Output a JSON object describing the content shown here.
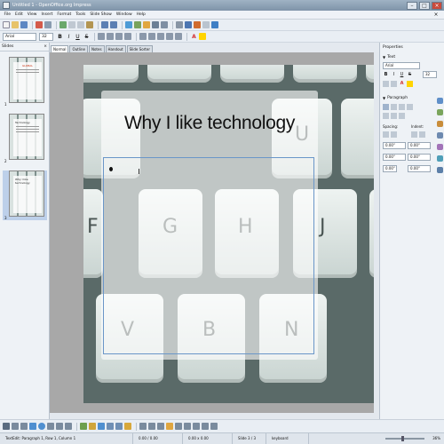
{
  "window": {
    "title": "Untitled 1 - OpenOffice.org Impress"
  },
  "menubar": [
    "File",
    "Edit",
    "View",
    "Insert",
    "Format",
    "Tools",
    "Slide Show",
    "Window",
    "Help"
  ],
  "formatting": {
    "font_name": "Arial",
    "font_size": "32",
    "buttons": [
      "B",
      "I",
      "U",
      "S",
      "A"
    ]
  },
  "slides_pane": {
    "title": "Slides",
    "thumbnails": [
      {
        "number": "1",
        "text": "GLOBAL"
      },
      {
        "number": "2",
        "text": "Technology"
      },
      {
        "number": "3",
        "text": "Why I like technology"
      }
    ]
  },
  "view_tabs": [
    "Normal",
    "Outline",
    "Notes",
    "Handout",
    "Slide Sorter"
  ],
  "slide": {
    "title": "Why I like technology",
    "key_letters": [
      "G",
      "H",
      "F",
      "J",
      "V",
      "B",
      "N",
      "U"
    ]
  },
  "properties": {
    "title": "Properties",
    "text_section": "Text",
    "font": "Arial",
    "size": "32",
    "paragraph_section": "Paragraph",
    "spacing_label": "Spacing:",
    "indent_label": "Indent:",
    "values": [
      "0.00\"",
      "0.00\"",
      "0.00\"",
      "0.00\"",
      "0.00\"",
      "0.00\""
    ]
  },
  "statusbar": {
    "position": "TextEdit: Paragraph 1, Row 1, Column 1",
    "coords": "0.00 / 0.00",
    "size": "0.00 x 0.00",
    "slide": "Slide 3 / 3",
    "layout": "keyboard",
    "zoom": "36%"
  },
  "colors": {
    "accent": "#3e6fb0",
    "font_color": "#d32f2f",
    "highlight": "#ffd400"
  }
}
